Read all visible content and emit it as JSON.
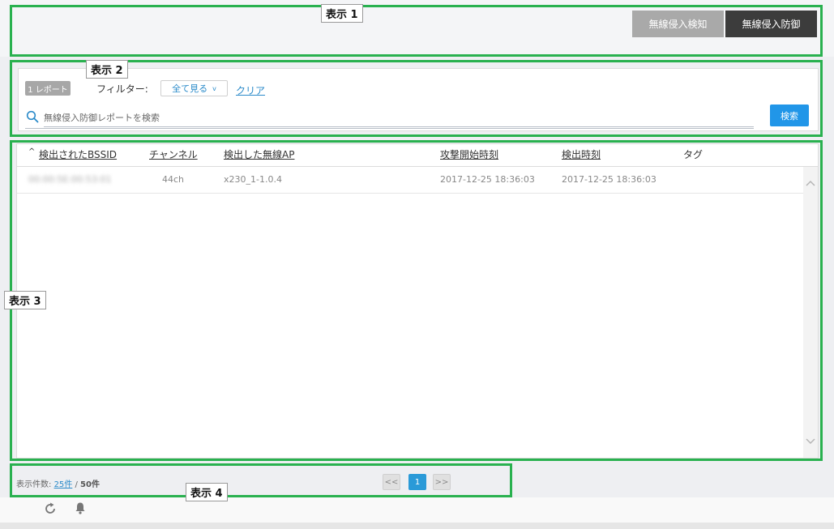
{
  "header": {
    "mode_buttons": [
      {
        "label": "無線侵入検知"
      },
      {
        "label": "無線侵入防御"
      }
    ]
  },
  "report_panel": {
    "report_count_badge": "1 レポート",
    "filter_label": "フィルター:",
    "filter_selected": "全て見る",
    "clear_link": "クリア",
    "search_placeholder": "無線侵入防御レポートを検索",
    "search_button": "検索"
  },
  "table": {
    "sort_indicator": "^",
    "columns": [
      "検出されたBSSID",
      "チャンネル",
      "検出した無線AP",
      "攻撃開始時刻",
      "検出時刻",
      "タグ"
    ],
    "rows": [
      {
        "bssid": "00:00:5E:00:53:01",
        "channel": "44ch",
        "ap": "x230_1-1.0.4",
        "attack_start": "2017-12-25 18:36:03",
        "detected_at": "2017-12-25 18:36:03",
        "tag": ""
      }
    ]
  },
  "pagination": {
    "count_label": "表示件数:",
    "per_page": "25件",
    "separator": "/",
    "total": "50件",
    "prev": "<<",
    "current_page": "1",
    "next": ">>"
  },
  "annotations": {
    "display1": "表示 1",
    "display2": "表示 2",
    "display3": "表示 3",
    "display4": "表示 4"
  },
  "colors": {
    "accent": "#2196e8",
    "annotation_border": "#29b14f",
    "mode_active": "#3c3c3c",
    "mode_inactive": "#a9a9a9"
  },
  "icons": {
    "search": "search-icon",
    "refresh": "refresh-icon",
    "bell": "bell-icon"
  }
}
